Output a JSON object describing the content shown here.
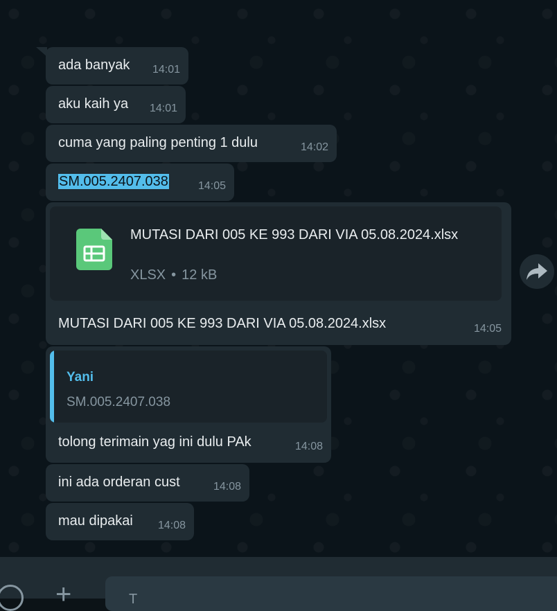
{
  "messages": [
    {
      "text": "ada banyak",
      "time": "14:01"
    },
    {
      "text": "aku kaih ya",
      "time": "14:01"
    },
    {
      "text": "cuma yang paling penting 1 dulu",
      "time": "14:02"
    },
    {
      "text": "SM.005.2407.038",
      "time": "14:05"
    },
    {
      "text": "tolong terimain yag ini dulu PAk",
      "time": "14:08"
    },
    {
      "text": "ini ada orderan cust",
      "time": "14:08"
    },
    {
      "text": "mau dipakai",
      "time": "14:08"
    }
  ],
  "file_message": {
    "file_name": "MUTASI DARI 005 KE 993 DARI VIA 05.08.2024.xlsx",
    "file_type": "XLSX",
    "separator": "•",
    "file_size": "12 kB",
    "caption": "MUTASI DARI 005 KE 993 DARI VIA 05.08.2024.xlsx",
    "time": "14:05",
    "icon": "spreadsheet-icon"
  },
  "reply": {
    "author": "Yani",
    "quoted_text": "SM.005.2407.038"
  },
  "composer": {
    "placeholder": "T"
  },
  "colors": {
    "bubble": "#202c33",
    "accent": "#53bdeb",
    "sheet_green": "#5ac87a"
  }
}
